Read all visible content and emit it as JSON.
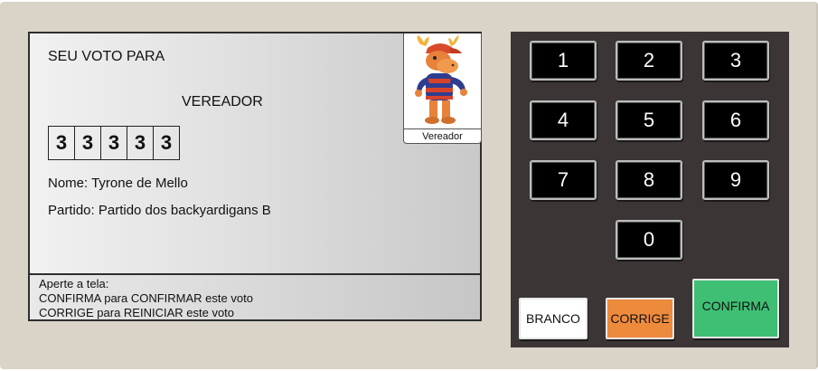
{
  "ballot": {
    "heading": "SEU VOTO PARA",
    "office": "VEREADOR",
    "digits": [
      "3",
      "3",
      "3",
      "3",
      "3"
    ],
    "name_line": "Nome: Tyrone de Mello",
    "party_line": "Partido: Partido dos backyardigans B",
    "photo_caption": "Vereador",
    "footer": {
      "line1": "Aperte a tela:",
      "line2": "CONFIRMA para CONFIRMAR este voto",
      "line3": "CORRIGE para REINICIAR este voto"
    }
  },
  "keypad": {
    "keys": [
      "1",
      "2",
      "3",
      "4",
      "5",
      "6",
      "7",
      "8",
      "9",
      "0"
    ],
    "branco_label": "BRANCO",
    "corrige_label": "CORRIGE",
    "confirma_label": "CONFIRMA"
  },
  "colors": {
    "case": "#d9d4c7",
    "keypad_panel": "#3b3535",
    "corrige": "#ee8a3c",
    "confirma": "#3fbf74",
    "branco": "#ffffff"
  }
}
